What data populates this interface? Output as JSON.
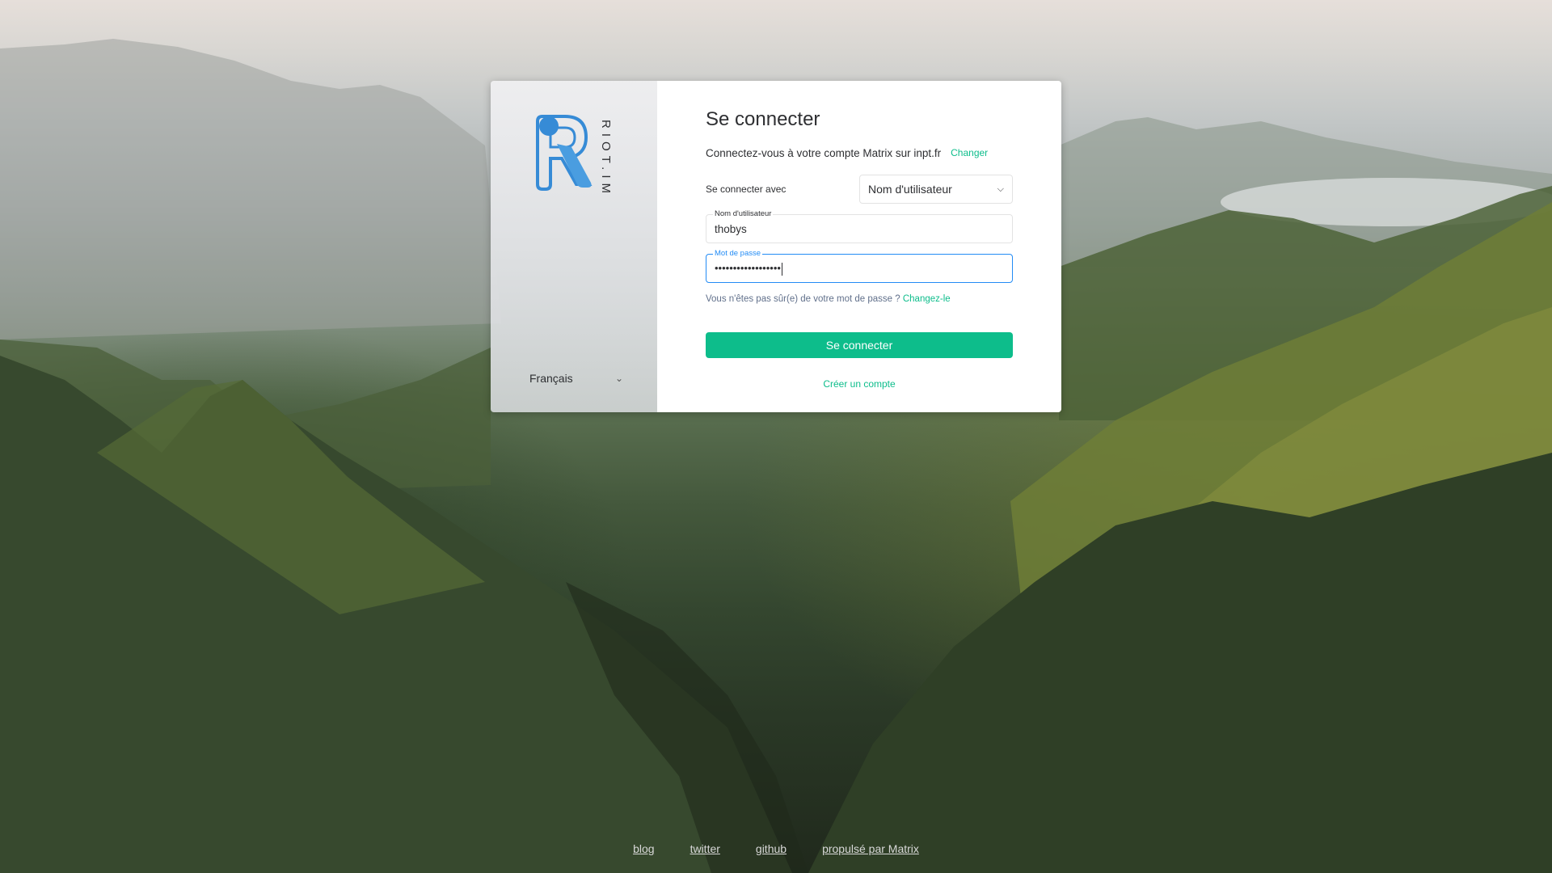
{
  "auth": {
    "brand_text": "RIOT.IM",
    "language": "Français",
    "title": "Se connecter",
    "server_text": "Connectez-vous à votre compte Matrix sur inpt.fr",
    "server_change": "Changer",
    "login_with_label": "Se connecter avec",
    "login_type": "Nom d'utilisateur",
    "username_label": "Nom d'utilisateur",
    "username_value": "thobys",
    "password_label": "Mot de passe",
    "password_value": "••••••••••••••••••",
    "forgot_text": "Vous n'êtes pas sûr(e) de votre mot de passe ?",
    "forgot_link": "Changez-le",
    "submit_label": "Se connecter",
    "create_account": "Créer un compte"
  },
  "footer": {
    "links": [
      "blog",
      "twitter",
      "github",
      "propulsé par Matrix"
    ]
  },
  "colors": {
    "accent": "#0dbd8b",
    "focus": "#238cf5",
    "brand_blue": "#368bd6"
  },
  "icons": {
    "logo": "riot-logo-icon",
    "lang_chevron": "chevron-down-icon",
    "select_chevron": "chevron-down-icon"
  }
}
